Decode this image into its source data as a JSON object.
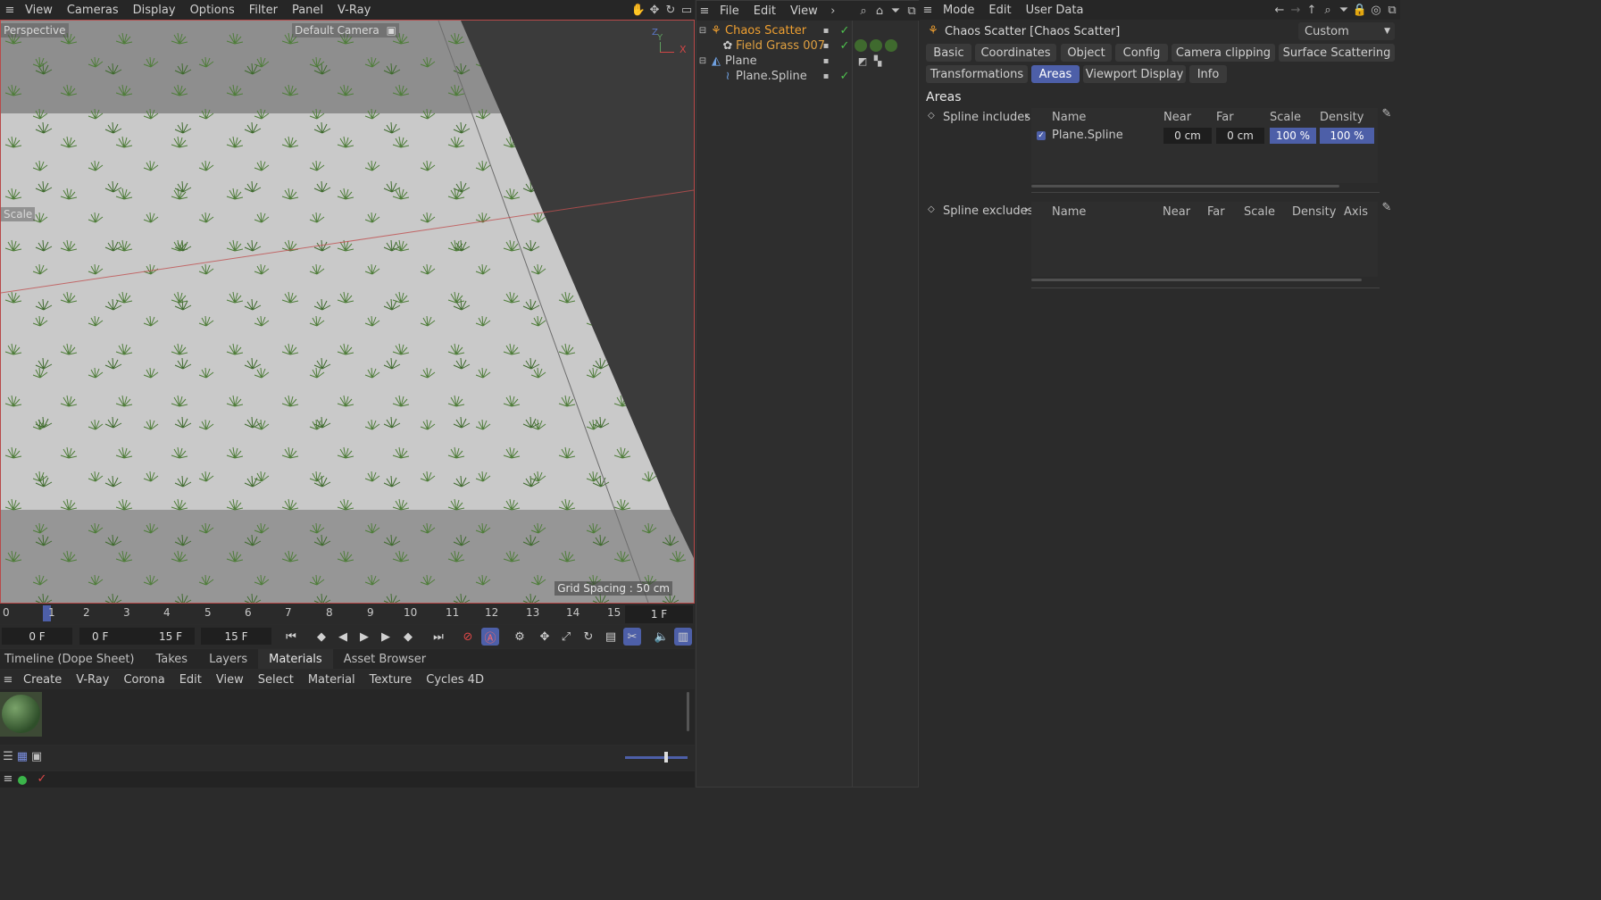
{
  "viewport_menu": [
    "View",
    "Cameras",
    "Display",
    "Options",
    "Filter",
    "Panel",
    "V-Ray"
  ],
  "viewport": {
    "view_name": "Perspective",
    "camera": "Default Camera",
    "scale_label": "Scale",
    "grid_spacing": "Grid Spacing : 50 cm",
    "axis_y": "Y",
    "axis_z": "Z",
    "axis_x": "X"
  },
  "timeline": {
    "ticks": [
      "0",
      "1",
      "2",
      "3",
      "4",
      "5",
      "6",
      "7",
      "8",
      "9",
      "10",
      "11",
      "12",
      "13",
      "14",
      "15"
    ],
    "current_frame_display": "1 F",
    "start": "0 F",
    "range_start": "0 F",
    "range_end": "15 F",
    "end": "15 F"
  },
  "bottom_tabs": [
    "Timeline (Dope Sheet)",
    "Takes",
    "Layers",
    "Materials",
    "Asset Browser"
  ],
  "material_menu": [
    "Create",
    "V-Ray",
    "Corona",
    "Edit",
    "View",
    "Select",
    "Material",
    "Texture",
    "Cycles 4D"
  ],
  "object_manager": {
    "menu": [
      "File",
      "Edit",
      "View"
    ],
    "objects": [
      {
        "name": "Chaos Scatter",
        "color": "#f0a030"
      },
      {
        "name": "Field Grass 007",
        "color": "#e0a040"
      },
      {
        "name": "Plane",
        "color": "#c8c8c8"
      },
      {
        "name": "Plane.Spline",
        "color": "#c8c8c8"
      }
    ]
  },
  "attribute_manager": {
    "menu": [
      "Mode",
      "Edit",
      "User Data"
    ],
    "title": "Chaos Scatter [Chaos Scatter]",
    "preset": "Custom",
    "tabs_row1": [
      "Basic",
      "Coordinates",
      "Object",
      "Config",
      "Camera clipping",
      "Surface Scattering"
    ],
    "tabs_row2": [
      "Transformations",
      "Areas",
      "Viewport Display",
      "Info"
    ],
    "active_tab": "Areas",
    "section_title": "Areas",
    "spline_includes": {
      "label": "Spline includes",
      "columns": [
        "Name",
        "Near",
        "Far",
        "Scale",
        "Density"
      ],
      "row": {
        "name": "Plane.Spline",
        "near": "0 cm",
        "far": "0 cm",
        "scale": "100 %",
        "density": "100 %"
      }
    },
    "spline_excludes": {
      "label": "Spline excludes",
      "columns": [
        "Name",
        "Near",
        "Far",
        "Scale",
        "Density",
        "Axis"
      ]
    }
  },
  "colors": {
    "accent": "#4d5fa8",
    "active_object": "#f0a030",
    "grass": "#4f7d3a"
  }
}
